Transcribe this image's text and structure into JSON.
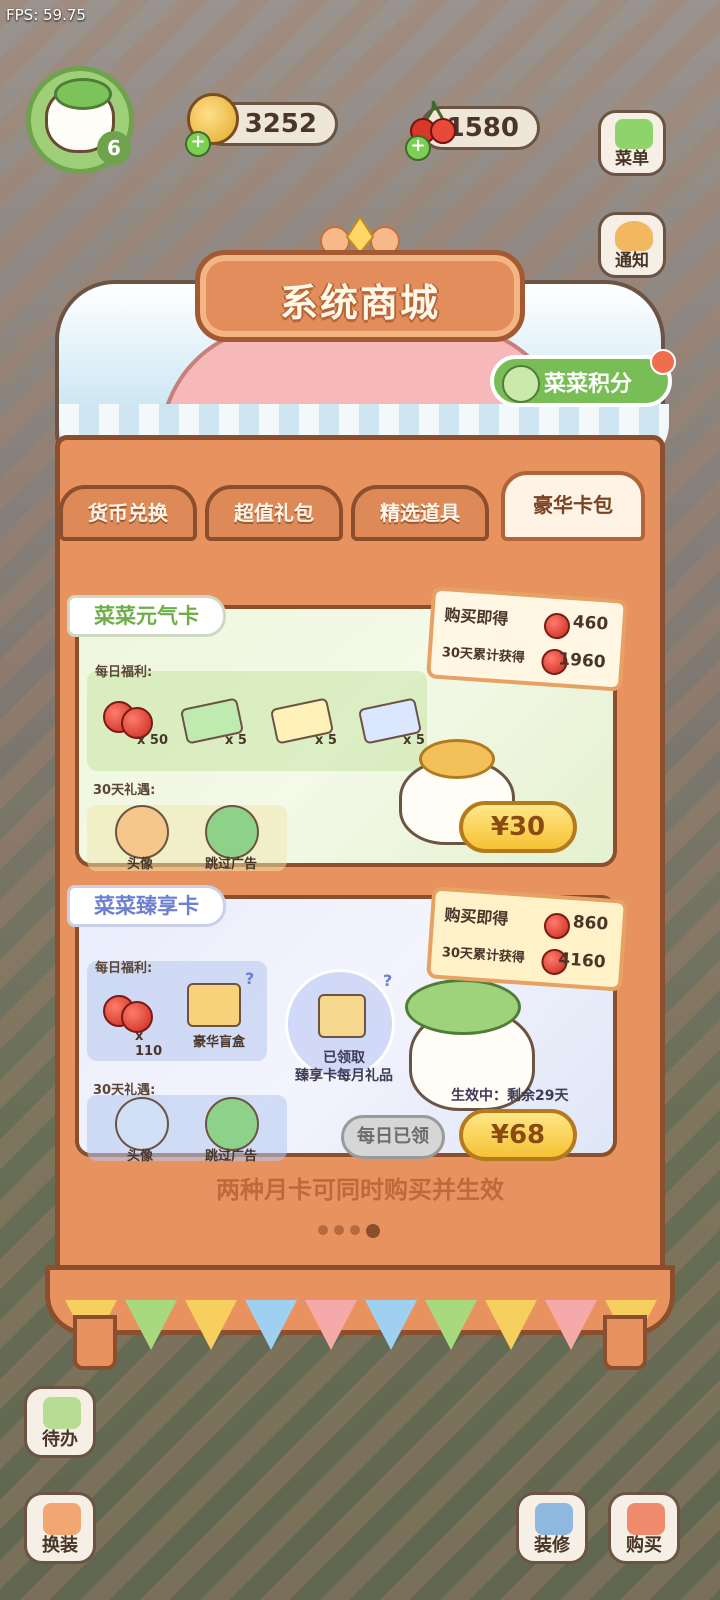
{
  "hud": {
    "fps": "FPS: 59.75",
    "level": "6",
    "coins": "3252",
    "cherries": "1580"
  },
  "side_menu": {
    "menu": "菜单",
    "notice": "通知"
  },
  "shop": {
    "title": "系统商城",
    "points_label": "菜菜积分",
    "tabs": [
      "货币兑换",
      "超值礼包",
      "精选道具",
      "豪华卡包"
    ],
    "active_tab": "豪华卡包",
    "card1": {
      "title": "菜菜元气卡",
      "daily_label": "每日福利:",
      "daily_items": [
        {
          "icon": "cherry-icon",
          "qty": "x 50"
        },
        {
          "icon": "ad-ticket-icon",
          "qty": "x 5"
        },
        {
          "icon": "bus-ticket-icon",
          "qty": "x 5"
        },
        {
          "icon": "card-ticket-icon",
          "qty": "x 5"
        }
      ],
      "gift_label": "30天礼遇:",
      "gifts": [
        "头像",
        "跳过广告"
      ],
      "bonus_buy_label": "购买即得",
      "bonus_buy_value": "460",
      "bonus_30_label": "30天累计获得",
      "bonus_30_value": "1960",
      "price": "¥30"
    },
    "card2": {
      "title": "菜菜臻享卡",
      "daily_label": "每日福利:",
      "daily_items": [
        {
          "icon": "cherry-icon",
          "qty": "x 110"
        },
        {
          "icon": "mystery-box-icon",
          "qty": "豪华盲盒"
        }
      ],
      "claimed_monthly": "已领取\n臻享卡每月礼品",
      "gift_label": "30天礼遇:",
      "gifts": [
        "头像",
        "跳过广告"
      ],
      "active_status": "生效中：剩余29天",
      "bonus_buy_label": "购买即得",
      "bonus_buy_value": "860",
      "bonus_30_label": "30天累计获得",
      "bonus_30_value": "4160",
      "claimed_label": "每日已领",
      "price": "¥68"
    },
    "footnote": "两种月卡可同时购买并生效",
    "page_count": 4,
    "active_page": 4
  },
  "bottom_menu": {
    "todo": "待办",
    "dress": "换装",
    "decorate": "装修",
    "buy": "购买"
  },
  "colors": {
    "cabinet": "#e8935f",
    "cabinet_border": "#8b4f2d",
    "green_accent": "#78bd55",
    "price_yellow": "#f6c234"
  }
}
